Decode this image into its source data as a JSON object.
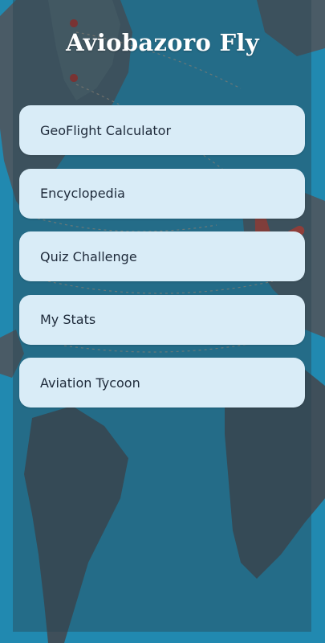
{
  "app": {
    "title": "Aviobazoro Fly"
  },
  "menu": {
    "items": [
      {
        "label": "GeoFlight Calculator"
      },
      {
        "label": "Encyclopedia"
      },
      {
        "label": "Quiz Challenge"
      },
      {
        "label": "My Stats"
      },
      {
        "label": "Aviation Tycoon"
      }
    ]
  },
  "icons": {
    "background": "world-map-illustration",
    "airplane": "airplane-icon",
    "pins": "map-pin-icon"
  },
  "colors": {
    "button_background": "#d9ecf7",
    "button_text": "#1e2a3a",
    "title_text": "#ffffff",
    "ocean": "#1d7da3",
    "airplane": "#d93a2a"
  }
}
